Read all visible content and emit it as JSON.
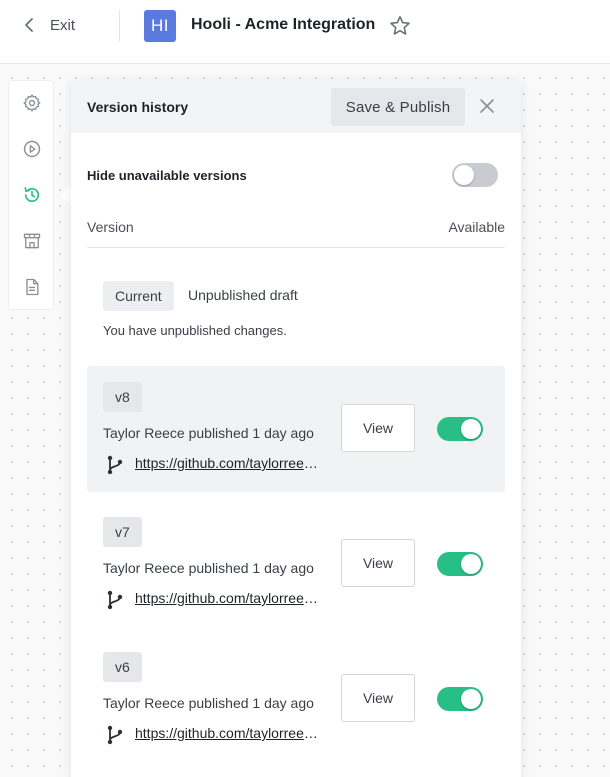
{
  "header": {
    "exit_label": "Exit",
    "app_badge": "HI",
    "app_title": "Hooli - Acme Integration",
    "favorite_icon": "star-icon"
  },
  "rail": {
    "items": [
      {
        "name": "settings",
        "icon": "gear-icon",
        "active": false
      },
      {
        "name": "test-runs",
        "icon": "play-circle-icon",
        "active": false
      },
      {
        "name": "version-history",
        "icon": "history-icon",
        "active": true
      },
      {
        "name": "marketplace",
        "icon": "storefront-icon",
        "active": false
      },
      {
        "name": "documentation",
        "icon": "document-icon",
        "active": false
      }
    ]
  },
  "panel": {
    "title": "Version history",
    "publish_label": "Save & Publish",
    "hide_unavailable_label": "Hide unavailable versions",
    "hide_unavailable_on": false,
    "columns": {
      "version": "Version",
      "available": "Available"
    },
    "current": {
      "chip": "Current",
      "label": "Unpublished draft",
      "note": "You have unpublished changes."
    },
    "versions": [
      {
        "tag": "v8",
        "meta": "Taylor Reece published 1 day ago",
        "link": "https://github.com/taylorreece/hooli-acme",
        "view_label": "View",
        "available": true,
        "highlighted": true
      },
      {
        "tag": "v7",
        "meta": "Taylor Reece published 1 day ago",
        "link": "https://github.com/taylorreece/hooli-acme",
        "view_label": "View",
        "available": true,
        "highlighted": false
      },
      {
        "tag": "v6",
        "meta": "Taylor Reece published 1 day ago",
        "link": "https://github.com/taylorreece/hooli-acme",
        "view_label": "View",
        "available": true,
        "highlighted": false
      }
    ]
  },
  "colors": {
    "accent_green": "#27bf86",
    "badge_blue": "#5a7ae0",
    "toggle_off": "#c9cbd0"
  }
}
